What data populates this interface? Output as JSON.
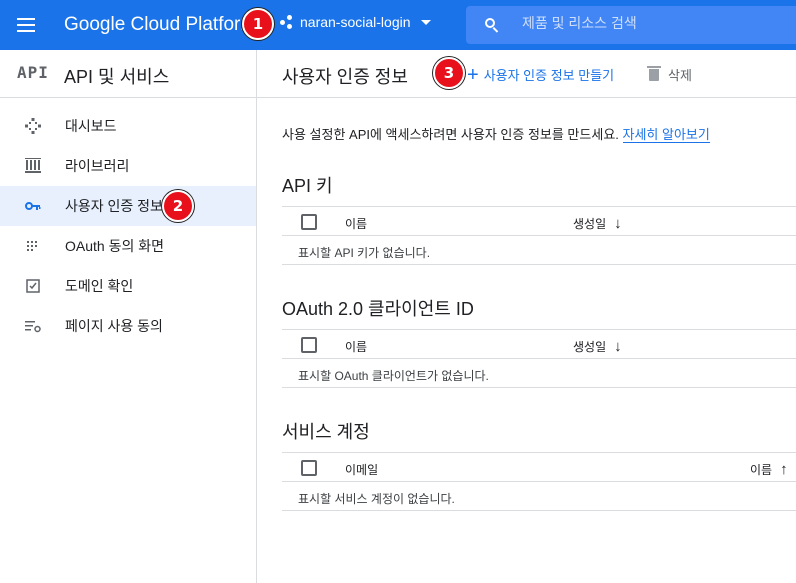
{
  "topbar": {
    "brand": "Google Cloud Platform",
    "project": "naran-social-login",
    "search_placeholder": "제품 및 리소스 검색"
  },
  "badges": [
    "1",
    "2",
    "3"
  ],
  "sidebar": {
    "logo": "API",
    "title": "API 및 서비스",
    "items": [
      {
        "label": "대시보드",
        "icon": "dashboard-icon"
      },
      {
        "label": "라이브러리",
        "icon": "library-icon"
      },
      {
        "label": "사용자 인증 정보",
        "icon": "key-icon",
        "active": true
      },
      {
        "label": "OAuth 동의 화면",
        "icon": "oauth-consent-icon"
      },
      {
        "label": "도메인 확인",
        "icon": "domain-check-icon"
      },
      {
        "label": "페이지 사용 동의",
        "icon": "page-consent-icon"
      }
    ]
  },
  "main": {
    "title": "사용자 인증 정보",
    "create_label": "사용자 인증 정보 만들기",
    "delete_label": "삭제",
    "intro_text": "사용 설정한 API에 액세스하려면 사용자 인증 정보를 만드세요.",
    "intro_link": "자세히 알아보기",
    "sections": [
      {
        "title": "API 키",
        "col1": "이름",
        "col2": "생성일",
        "sort": "↓",
        "empty": "표시할 API 키가 없습니다."
      },
      {
        "title": "OAuth 2.0 클라이언트 ID",
        "col1": "이름",
        "col2": "생성일",
        "sort": "↓",
        "empty": "표시할 OAuth 클라이언트가 없습니다."
      },
      {
        "title": "서비스 계정",
        "col1": "이메일",
        "col2": "이름",
        "sort": "↑",
        "empty": "표시할 서비스 계정이 없습니다."
      }
    ]
  },
  "colors": {
    "topbar": "#1a73e8",
    "active_nav": "#e8f0fe",
    "link": "#1a73e8",
    "badge": "#e8101a"
  }
}
